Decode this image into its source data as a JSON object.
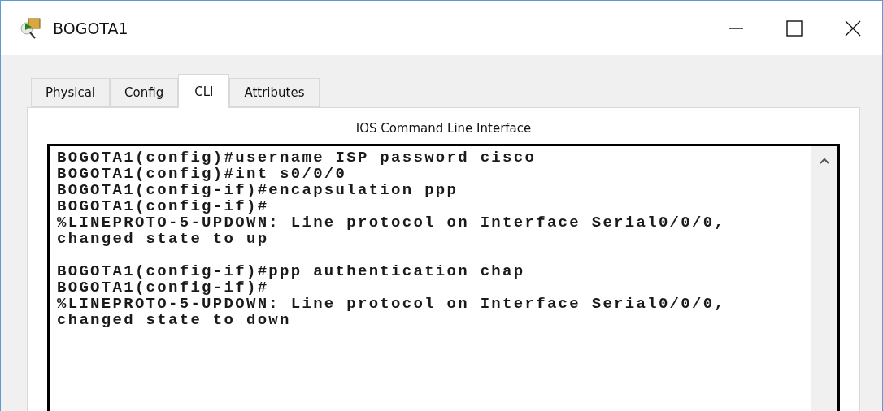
{
  "window": {
    "title": "BOGOTA1"
  },
  "tabs": [
    {
      "label": "Physical",
      "selected": false
    },
    {
      "label": "Config",
      "selected": false
    },
    {
      "label": "CLI",
      "selected": true
    },
    {
      "label": "Attributes",
      "selected": false
    }
  ],
  "panel_title": "IOS Command Line Interface",
  "terminal": {
    "blocks": [
      [
        "BOGOTA1(config)#username ISP password cisco",
        "BOGOTA1(config)#int s0/0/0",
        "BOGOTA1(config-if)#encapsulation ppp",
        "BOGOTA1(config-if)#",
        "%LINEPROTO-5-UPDOWN: Line protocol on Interface Serial0/0/0,",
        "changed state to up"
      ],
      [
        "BOGOTA1(config-if)#ppp authentication chap",
        "BOGOTA1(config-if)#",
        "%LINEPROTO-5-UPDOWN: Line protocol on Interface Serial0/0/0,",
        "changed state to down"
      ]
    ]
  }
}
